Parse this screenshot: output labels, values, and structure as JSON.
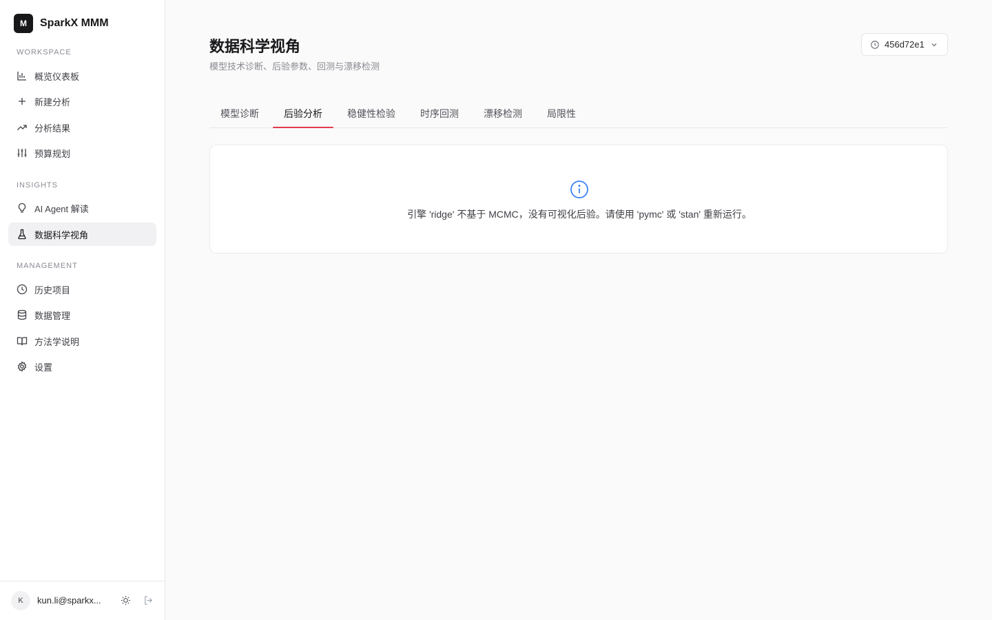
{
  "brand": {
    "logo_letter": "M",
    "name": "SparkX MMM"
  },
  "sidebar": {
    "sections": {
      "workspace": "WORKSPACE",
      "insights": "INSIGHTS",
      "management": "MANAGEMENT"
    },
    "items": [
      {
        "label": "概览仪表板",
        "icon": "bar-chart-icon"
      },
      {
        "label": "新建分析",
        "icon": "plus-icon"
      },
      {
        "label": "分析结果",
        "icon": "trending-up-icon"
      },
      {
        "label": "预算规划",
        "icon": "sliders-icon"
      },
      {
        "label": "AI Agent 解读",
        "icon": "lightbulb-icon"
      },
      {
        "label": "数据科学视角",
        "icon": "flask-icon",
        "active": true
      },
      {
        "label": "历史项目",
        "icon": "clock-icon"
      },
      {
        "label": "数据管理",
        "icon": "database-icon"
      },
      {
        "label": "方法学说明",
        "icon": "book-icon"
      },
      {
        "label": "设置",
        "icon": "gear-icon"
      }
    ]
  },
  "user": {
    "avatar_letter": "K",
    "email": "kun.li@sparkx..."
  },
  "header": {
    "title": "数据科学视角",
    "subtitle": "模型技术诊断、后验参数、回测与漂移检测",
    "version": "456d72e1"
  },
  "tabs": [
    {
      "label": "模型诊断"
    },
    {
      "label": "后验分析",
      "active": true
    },
    {
      "label": "稳健性检验"
    },
    {
      "label": "时序回测"
    },
    {
      "label": "漂移检测"
    },
    {
      "label": "局限性"
    }
  ],
  "notice": {
    "message": "引擎 'ridge' 不基于 MCMC，没有可视化后验。请使用 'pymc' 或 'stan' 重新运行。"
  },
  "colors": {
    "accent": "#e03a4a",
    "info": "#3b82f6",
    "brand_dark": "#18181b"
  }
}
